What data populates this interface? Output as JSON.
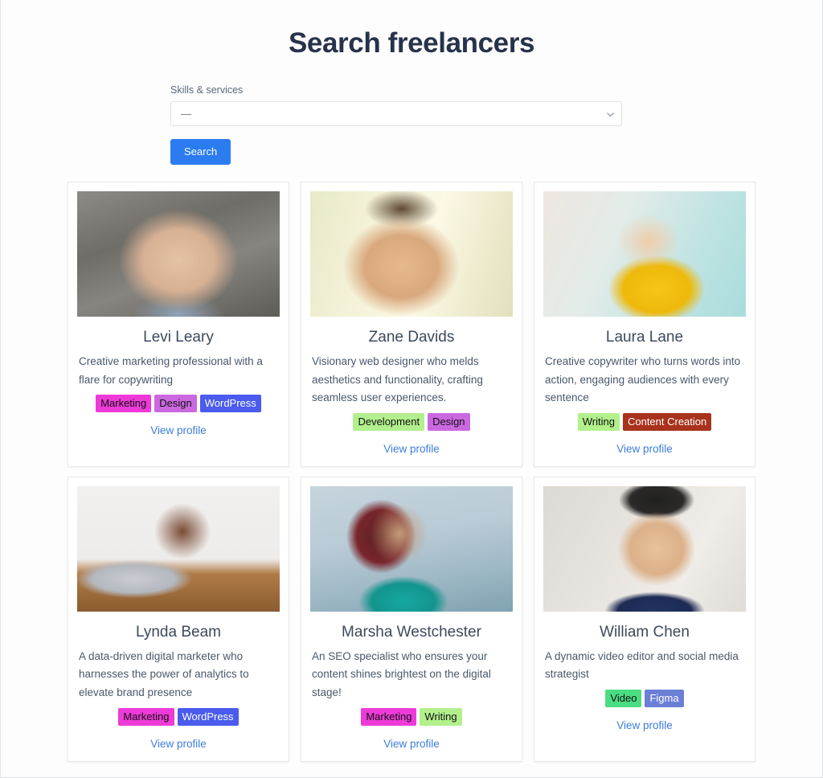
{
  "header": {
    "title": "Search freelancers"
  },
  "search": {
    "label": "Skills & services",
    "selected_value": "—",
    "dropdown_icon": "chevron-down-icon",
    "button_label": "Search"
  },
  "cards": [
    {
      "name": "Levi Leary",
      "bio": "Creative marketing professional with a flare for copywriting",
      "photo_class": "ph-levi",
      "photo_alt": "smiling-bald-man-portrait",
      "tags": [
        {
          "label": "Marketing",
          "bg": "#ed3ad8",
          "fg": "#111111"
        },
        {
          "label": "Design",
          "bg": "#cb68e0",
          "fg": "#111111"
        },
        {
          "label": "WordPress",
          "bg": "#4a5bed",
          "fg": "#ffffff"
        }
      ],
      "link_label": "View profile"
    },
    {
      "name": "Zane Davids",
      "bio": "Visionary web designer who melds aesthetics and functionality, crafting seamless user experiences.",
      "photo_class": "ph-zane",
      "photo_alt": "smiling-man-with-glasses-portrait",
      "tags": [
        {
          "label": "Development",
          "bg": "#b2ef8d",
          "fg": "#111111"
        },
        {
          "label": "Design",
          "bg": "#cb68e0",
          "fg": "#111111"
        }
      ],
      "link_label": "View profile"
    },
    {
      "name": "Laura Lane",
      "bio": "Creative copywriter who turns words into action, engaging audiences with every sentence",
      "photo_class": "ph-laura",
      "photo_alt": "woman-holding-paintbrush-portrait",
      "tags": [
        {
          "label": "Writing",
          "bg": "#b2f08c",
          "fg": "#111111"
        },
        {
          "label": "Content Creation",
          "bg": "#a8321c",
          "fg": "#ffffff"
        }
      ],
      "link_label": "View profile"
    },
    {
      "name": "Lynda Beam",
      "bio": "A data-driven digital marketer who harnesses the power of analytics to elevate brand presence",
      "photo_class": "ph-lynda",
      "photo_alt": "woman-working-on-laptop",
      "tags": [
        {
          "label": "Marketing",
          "bg": "#ed3ad8",
          "fg": "#111111"
        },
        {
          "label": "WordPress",
          "bg": "#4a5bed",
          "fg": "#ffffff"
        }
      ],
      "link_label": "View profile"
    },
    {
      "name": "Marsha Westchester",
      "bio": "An SEO specialist who ensures your content shines brightest on the digital stage!",
      "photo_class": "ph-marsha",
      "photo_alt": "woman-with-curly-hair-holding-phone",
      "tags": [
        {
          "label": "Marketing",
          "bg": "#ed3ad8",
          "fg": "#111111"
        },
        {
          "label": "Writing",
          "bg": "#b2f08c",
          "fg": "#111111"
        }
      ],
      "link_label": "View profile"
    },
    {
      "name": "William Chen",
      "bio": "A dynamic video editor and social media strategist",
      "photo_class": "ph-william",
      "photo_alt": "man-in-suit-portrait",
      "tags": [
        {
          "label": "Video",
          "bg": "#4bdd82",
          "fg": "#111111"
        },
        {
          "label": "Figma",
          "bg": "#6b7fd7",
          "fg": "#ffffff"
        }
      ],
      "link_label": "View profile"
    }
  ],
  "colors": {
    "accent": "#2b7cf0",
    "link": "#3b7ddd",
    "title": "#26334a",
    "page_bg": "#fdfdfd"
  }
}
